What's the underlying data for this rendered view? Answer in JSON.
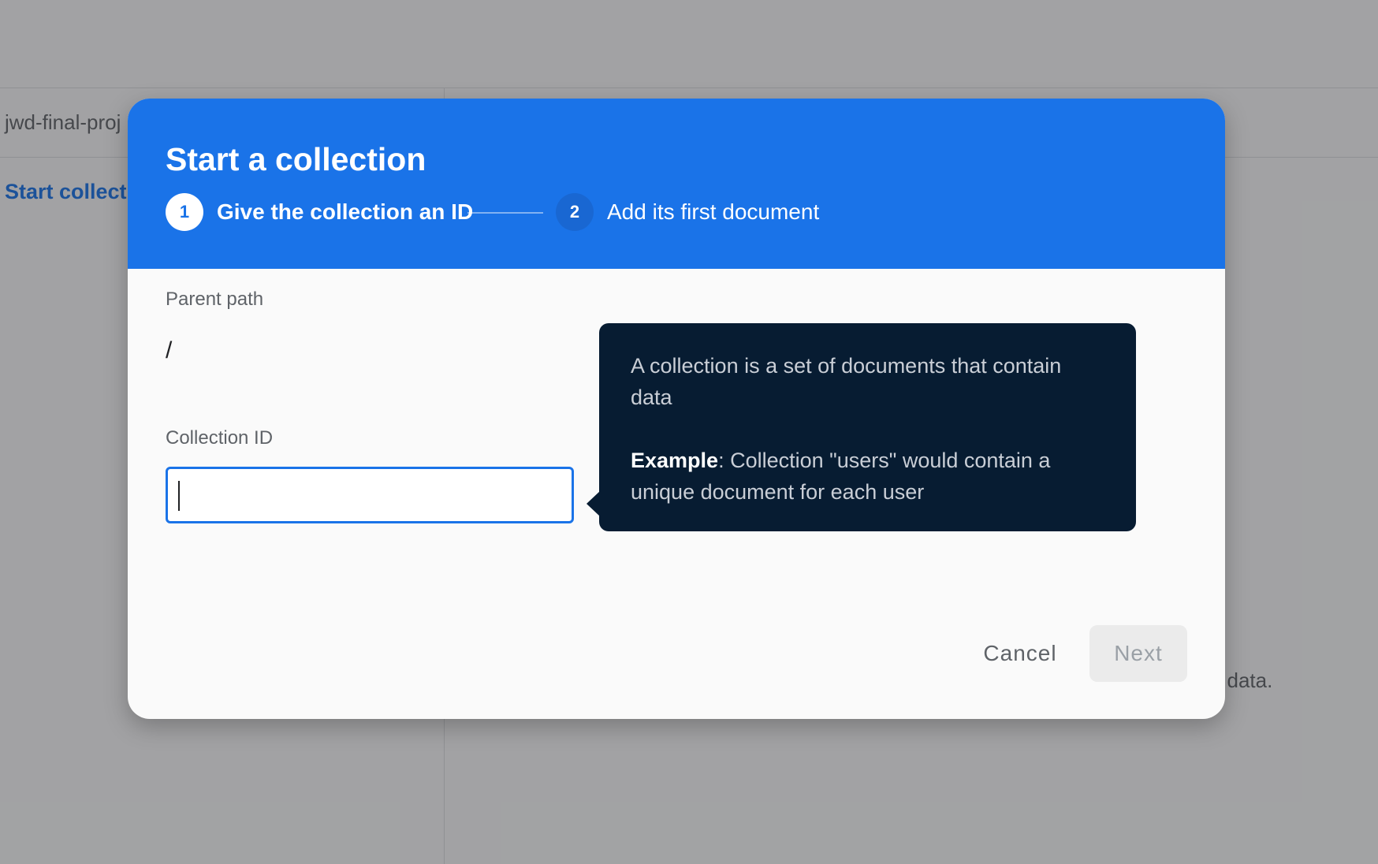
{
  "background": {
    "project_name": "jwd-final-proj",
    "start_collection_link": "Start collect",
    "hint_text": "ust add data."
  },
  "dialog": {
    "title": "Start a collection",
    "steps": [
      {
        "number": "1",
        "label": "Give the collection an ID",
        "state": "active"
      },
      {
        "number": "2",
        "label": "Add its first document",
        "state": "inactive"
      }
    ],
    "parent_path": {
      "label": "Parent path",
      "value": "/"
    },
    "collection_id": {
      "label": "Collection ID",
      "value": "",
      "placeholder": ""
    },
    "tooltip": {
      "line1": "A collection is a set of documents that contain data",
      "example_label": "Example",
      "example_text": ": Collection \"users\" would contain a unique document for each user"
    },
    "buttons": {
      "cancel": "Cancel",
      "next": "Next"
    }
  },
  "colors": {
    "primary": "#1a73e8",
    "tooltip_bg": "#071c32",
    "scrim": "rgba(32,33,36,0.40)"
  }
}
